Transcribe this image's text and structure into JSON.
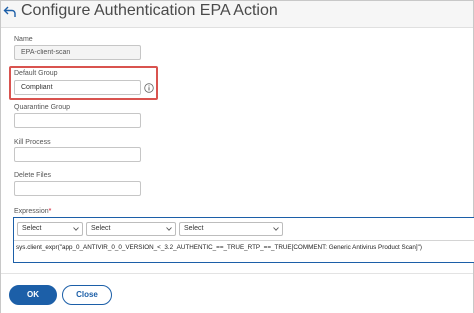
{
  "header": {
    "title": "Configure Authentication EPA Action"
  },
  "form": {
    "name": {
      "label": "Name",
      "value": "EPA-client-scan"
    },
    "default_group": {
      "label": "Default Group",
      "value": "Compliant"
    },
    "quarantine_group": {
      "label": "Quarantine Group",
      "value": ""
    },
    "kill_process": {
      "label": "Kill Process",
      "value": ""
    },
    "delete_files": {
      "label": "Delete Files",
      "value": ""
    },
    "expression": {
      "label": "Expression",
      "required_marker": "*",
      "selects": [
        "Select",
        "Select",
        "Select"
      ],
      "value": "sys.client_expr(\"app_0_ANTIVIR_0_0_VERSION_<_3.2_AUTHENTIC_==_TRUE_RTP_==_TRUE[COMMENT: Generic Antivirus Product Scan]\")"
    }
  },
  "footer": {
    "ok_label": "OK",
    "close_label": "Close"
  },
  "colors": {
    "accent": "#1c5fa8",
    "highlight": "#d9534f",
    "required": "#d0021b"
  }
}
